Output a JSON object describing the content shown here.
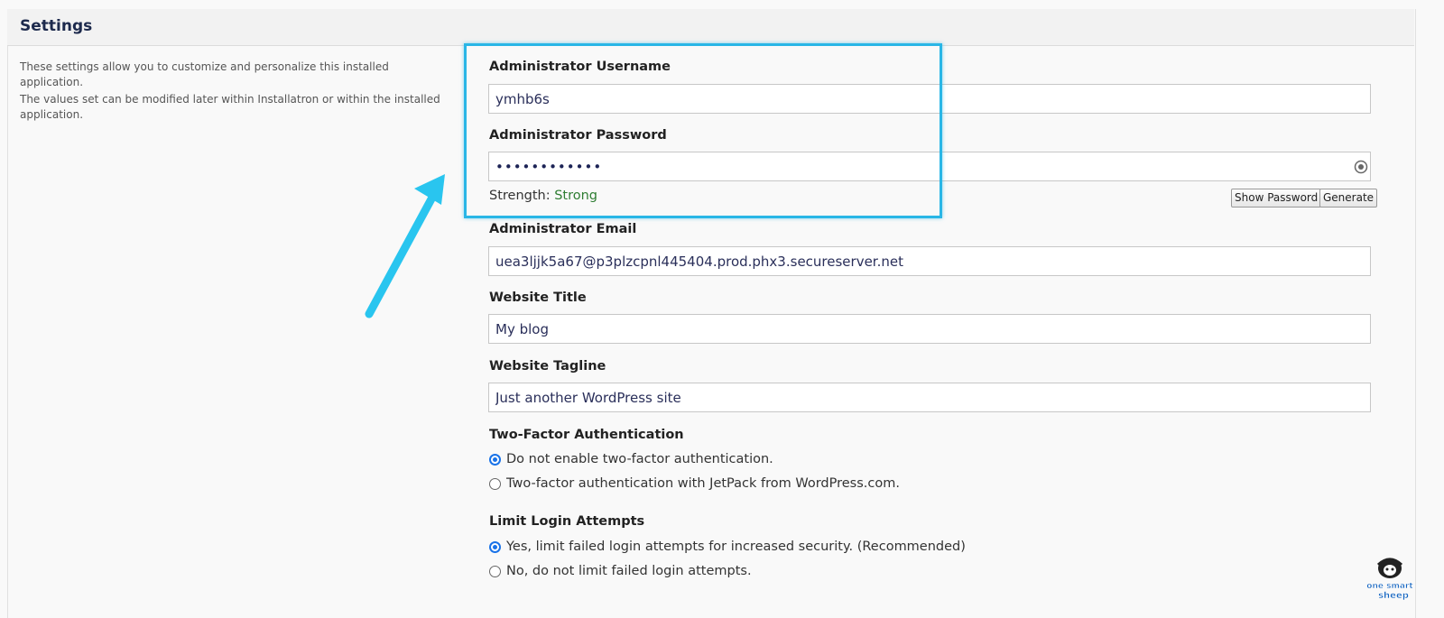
{
  "settings": {
    "title": "Settings",
    "description_1": "These settings allow you to customize and personalize this installed application.",
    "description_2": "The values set can be modified later within Installatron or within the installed application."
  },
  "admin_username": {
    "label": "Administrator Username",
    "value": "ymhb6s"
  },
  "admin_password": {
    "label": "Administrator Password",
    "value": "••••••••••••",
    "strength_label": "Strength:",
    "strength_value": "Strong",
    "show_password_label": "Show Password",
    "generate_label": "Generate",
    "reveal_icon": "password-reveal-icon"
  },
  "admin_email": {
    "label": "Administrator Email",
    "value": "uea3ljjk5a67@p3plzcpnl445404.prod.phx3.secureserver.net"
  },
  "website_title": {
    "label": "Website Title",
    "value": "My blog"
  },
  "website_tagline": {
    "label": "Website Tagline",
    "value": "Just another WordPress site"
  },
  "two_factor": {
    "label": "Two-Factor Authentication",
    "options": [
      {
        "label": "Do not enable two-factor authentication.",
        "checked": true
      },
      {
        "label": "Two-factor authentication with JetPack from WordPress.com.",
        "checked": false
      }
    ]
  },
  "limit_login": {
    "label": "Limit Login Attempts",
    "options": [
      {
        "label": "Yes, limit failed login attempts for increased security. (Recommended)",
        "checked": true
      },
      {
        "label": "No, do not limit failed login attempts.",
        "checked": false
      }
    ]
  },
  "annotation": {
    "highlight_color": "#29b6e6",
    "arrow_color": "#29c5ef"
  },
  "logo": {
    "text_line_1": "one smart",
    "text_line_2": "sheep"
  },
  "colors": {
    "input_text": "#2a2f5a",
    "strength_strong": "#2e7d32",
    "radio_checked": "#1a73e8",
    "section_title": "#1d2a4d"
  }
}
